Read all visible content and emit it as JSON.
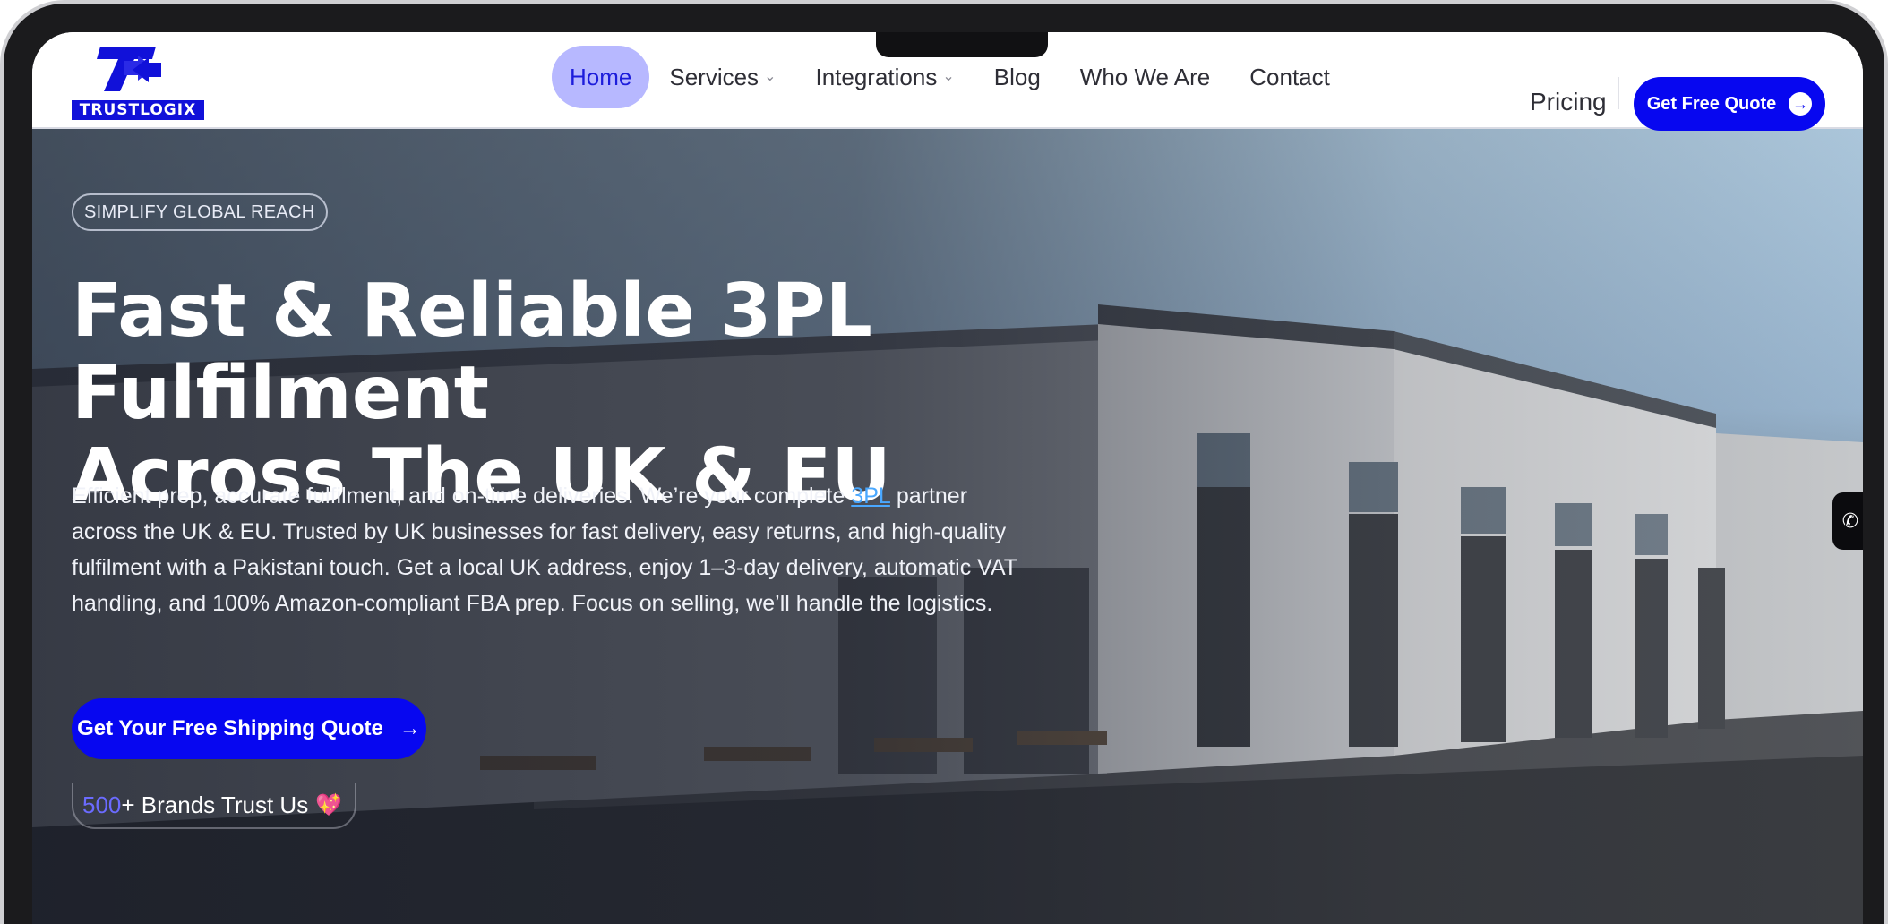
{
  "brand": {
    "logo_text": "TRUSTLOGIX",
    "colors": {
      "primary": "#0707f0",
      "nav_active_bg": "#b7b8ff",
      "link": "#4aa8ff"
    }
  },
  "nav": {
    "items": [
      {
        "label": "Home",
        "active": true,
        "dropdown": false
      },
      {
        "label": "Services",
        "active": false,
        "dropdown": true
      },
      {
        "label": "Integrations",
        "active": false,
        "dropdown": true
      },
      {
        "label": "Blog",
        "active": false,
        "dropdown": false
      },
      {
        "label": "Who We Are",
        "active": false,
        "dropdown": false
      },
      {
        "label": "Contact",
        "active": false,
        "dropdown": false
      }
    ],
    "pricing": "Pricing",
    "quote_button": "Get Free Quote",
    "chevron_icon": "chevron-down-icon",
    "arrow_icon": "arrow-right-circle-icon"
  },
  "hero": {
    "tag": "SIMPLIFY GLOBAL REACH",
    "headline_line1": "Fast & Reliable 3PL Fulfilment",
    "headline_line2": "Across The UK & EU",
    "description_before_link": "Efficient prep, accurate fulfilment, and on-time deliveries. We’re your complete ",
    "description_link": "3PL",
    "description_after_link": " partner across the UK & EU. Trusted by UK businesses for fast delivery, easy returns, and high-quality fulfilment with a Pakistani touch. Get a local UK address, enjoy 1–3-day delivery, automatic VAT handling, and 100% Amazon-compliant FBA prep. Focus on selling, we’ll handle the logistics.",
    "cta_label": "Get Your Free Shipping Quote",
    "trust_number": "500",
    "trust_text": "+ Brands Trust Us",
    "trust_icon": "heart-icon",
    "side_icon": "whatsapp-icon"
  }
}
